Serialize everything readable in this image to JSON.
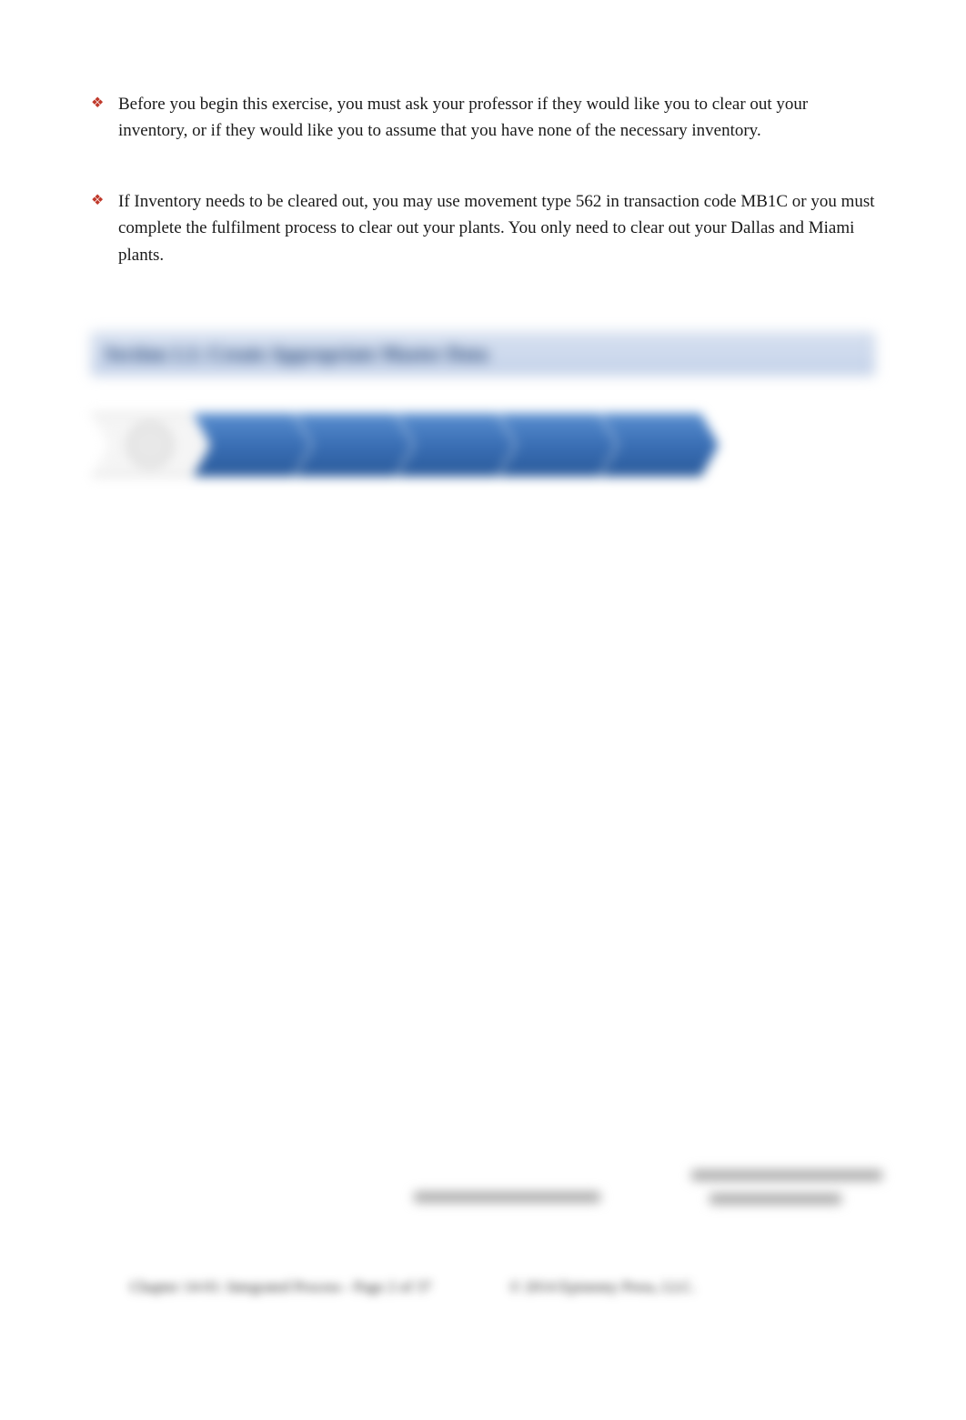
{
  "notes": [
    {
      "text": "Before you begin this exercise, you must ask your professor if they would like you to clear out your inventory, or if they would like you to assume that you have none of the necessary inventory."
    },
    {
      "text": "If Inventory needs to be cleared out, you may use movement type 562 in transaction code MB1C or you must complete the fulfilment process to clear out your plants. You only need to clear out your Dallas and Miami plants."
    }
  ],
  "section_header": "Section 1.1: Create Appropriate Master Data",
  "footer": {
    "left": "Chapter 14-01: Integrated Process - Page 2 of 37",
    "right": "© 2014 Epistemy Press, LLC."
  }
}
